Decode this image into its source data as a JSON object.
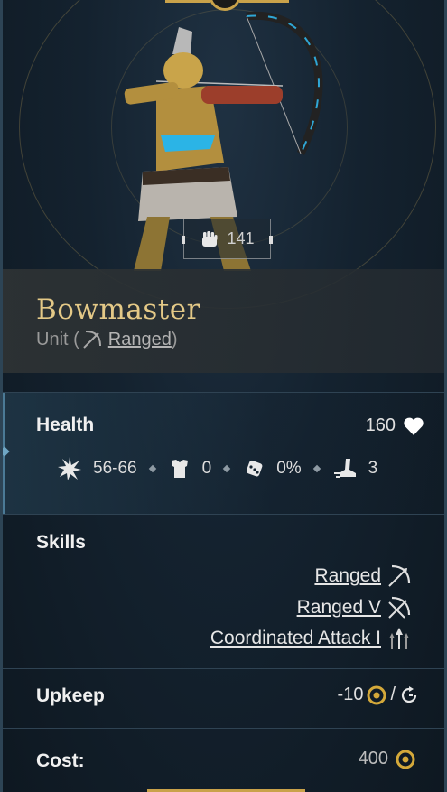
{
  "unit": {
    "name": "Bowmaster",
    "type_prefix": "Unit (",
    "type_link": "Ranged",
    "type_suffix": ")",
    "power": "141"
  },
  "health": {
    "label": "Health",
    "value": "160"
  },
  "stats": {
    "damage": "56-66",
    "defense": "0",
    "chance": "0%",
    "movement": "3"
  },
  "skills": {
    "label": "Skills",
    "items": [
      {
        "label": "Ranged",
        "icon": "ranged-icon"
      },
      {
        "label": "Ranged V",
        "icon": "ranged-v-icon"
      },
      {
        "label": "Coordinated Attack I",
        "icon": "coordinated-attack-icon"
      }
    ]
  },
  "upkeep": {
    "label": "Upkeep",
    "value": "-10",
    "separator": "/"
  },
  "cost": {
    "label": "Cost:",
    "value": "400"
  },
  "colors": {
    "gold": "#c9a24a",
    "name_gold": "#e4c987",
    "accent_blue": "#4b7a96"
  }
}
